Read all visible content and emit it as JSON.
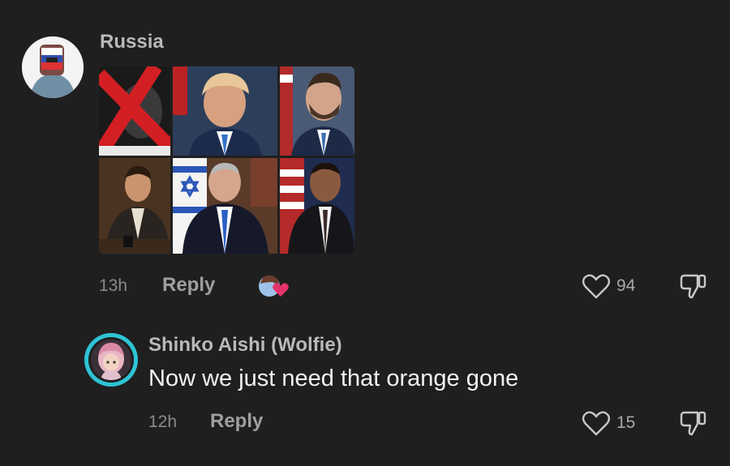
{
  "comment1": {
    "username": "Russia",
    "time": "13h",
    "reply_label": "Reply",
    "likes": "94",
    "photos": [
      "crossed-out-portrait",
      "orange-hair-portrait",
      "bearded-man-portrait",
      "man-at-desk-portrait",
      "israel-flag-portrait",
      "usa-flag-portrait"
    ]
  },
  "comment2": {
    "username": "Shinko Aishi (Wolfie)",
    "text": "Now we just need that orange gone",
    "time": "12h",
    "reply_label": "Reply",
    "likes": "15"
  },
  "colors": {
    "background": "#1f1f1f",
    "avatar_ring": "#2ec4d6"
  }
}
